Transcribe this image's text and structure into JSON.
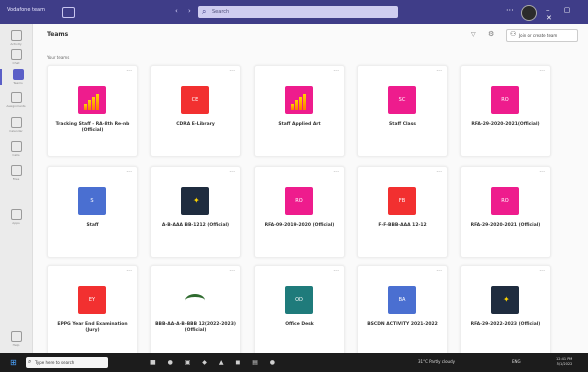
{
  "app": {
    "title": "Vodafone team"
  },
  "search": {
    "placeholder": "Search"
  },
  "rail": [
    {
      "label": "Activity",
      "icon": "bell-icon"
    },
    {
      "label": "Chat",
      "icon": "chat-icon"
    },
    {
      "label": "Teams",
      "icon": "teams-icon",
      "active": true
    },
    {
      "label": "Assignments",
      "icon": "assignment-icon"
    },
    {
      "label": "Calendar",
      "icon": "calendar-icon"
    },
    {
      "label": "Calls",
      "icon": "phone-icon"
    },
    {
      "label": "Files",
      "icon": "file-icon"
    },
    {
      "label": "Apps",
      "icon": "apps-icon"
    },
    {
      "label": "Help",
      "icon": "help-icon"
    }
  ],
  "header": {
    "title": "Teams",
    "join_label": "Join or create team"
  },
  "section": {
    "label": "Your teams"
  },
  "teams": [
    {
      "name": "Tracking Staff - RA-8th Re-nb (Official)",
      "icon": "chart",
      "tile_text": ""
    },
    {
      "name": "CDRA E-Library",
      "icon": "red",
      "tile_text": "CE"
    },
    {
      "name": "Staff Applied Art",
      "icon": "chart",
      "tile_text": ""
    },
    {
      "name": "Staff Class",
      "icon": "pink",
      "tile_text": "SC"
    },
    {
      "name": "RFA-29-2020-2021(Official)",
      "icon": "pink",
      "tile_text": "RO"
    },
    {
      "name": "Staff",
      "icon": "blue",
      "tile_text": "S"
    },
    {
      "name": "A-B-AAA BB-1212 (Official)",
      "icon": "navy",
      "tile_text": ""
    },
    {
      "name": "RFA-09-2019-2020 (Official)",
      "icon": "pink",
      "tile_text": "RO"
    },
    {
      "name": "F-F-BBB-AAA 12-12",
      "icon": "red",
      "tile_text": "FB"
    },
    {
      "name": "RFA-29-2020-2021 (Official)",
      "icon": "pink",
      "tile_text": "RO"
    },
    {
      "name": "EPPG Year End Examination (Jury)",
      "icon": "red",
      "tile_text": "EY"
    },
    {
      "name": "BBB-AA-A-B-BBB 12(2022-2023) (Official)",
      "icon": "white",
      "tile_text": ""
    },
    {
      "name": "Office Desk",
      "icon": "teal",
      "tile_text": "OD"
    },
    {
      "name": "BSCDN ACTIVITY 2021-2022",
      "icon": "blue",
      "tile_text": "BA"
    },
    {
      "name": "RFA-29-2022-2023 (Official)",
      "icon": "navy",
      "tile_text": ""
    }
  ],
  "taskbar": {
    "search_placeholder": "Type here to search",
    "weather": "31°C Partly cloudy",
    "tray": "ENG",
    "time": "12:41 PM",
    "date": "5/1/2022"
  }
}
